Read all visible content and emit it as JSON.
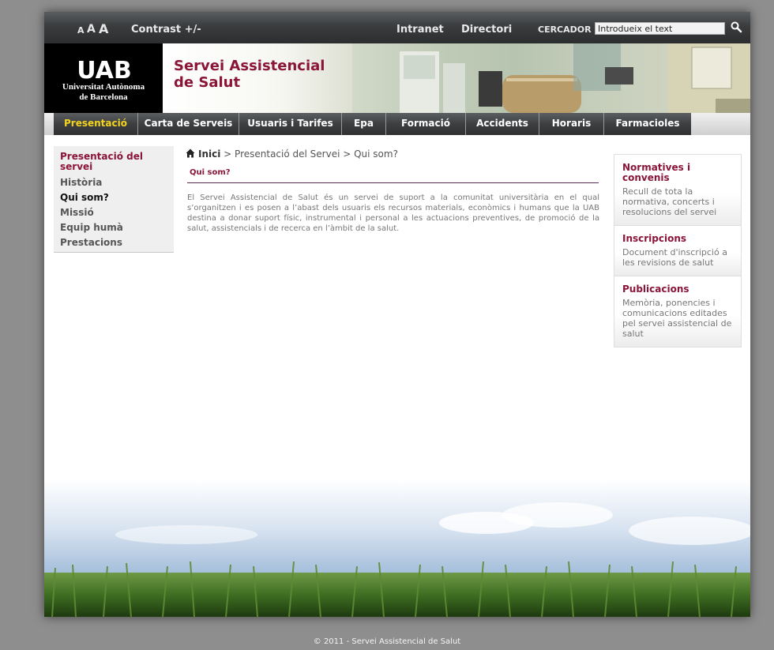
{
  "topbar": {
    "font_small": "A",
    "font_medium": "A",
    "font_large": "A",
    "contrast": "Contrast +/-",
    "intranet": "Intranet",
    "directori": "Directori",
    "search_label": "CERCADOR",
    "search_placeholder": "Introdueix el text",
    "search_icon": "magnifier-icon"
  },
  "header": {
    "logo_mark": "UAB",
    "logo_line1": "Universitat Autònoma",
    "logo_line2": "de Barcelona",
    "title_line1": "Servei Assistencial",
    "title_line2": "de Salut"
  },
  "nav": {
    "items": [
      {
        "label": "Presentació",
        "active": true
      },
      {
        "label": "Carta de Serveis",
        "active": false
      },
      {
        "label": "Usuaris i Tarifes",
        "active": false
      },
      {
        "label": "Epa",
        "active": false
      },
      {
        "label": "Formació",
        "active": false
      },
      {
        "label": "Accidents",
        "active": false
      },
      {
        "label": "Horaris",
        "active": false
      },
      {
        "label": "Farmacioles",
        "active": false
      }
    ]
  },
  "leftnav": {
    "heading": "Presentació del servei",
    "items": [
      "Història",
      "Qui som?",
      "Missió",
      "Equip humà",
      "Prestacions"
    ]
  },
  "breadcrumb": {
    "home_icon": "home-icon",
    "home": "Inici",
    "sep": " > ",
    "level1": "Presentació del Servei",
    "level2": "Qui som?"
  },
  "main": {
    "title": "Qui som?",
    "body": "El Servei Assistencial de Salut és un servei de suport a la comunitat universitària en el qual s’organitzen i es posen a l’abast dels usuaris els recursos materials, econòmics i humans que la UAB destina a donar suport físic, instrumental i personal a les actuacions preventives, de promoció de la salut, assistencials i de recerca en l’àmbit de la salut."
  },
  "sidebar_right": [
    {
      "title": "Normatives i convenis",
      "text": "Recull de tota la normativa, concerts i resolucions del servei"
    },
    {
      "title": "Inscripcions",
      "text": "Document d'inscripció a les revisions de salut"
    },
    {
      "title": "Publicacions",
      "text": "Memòria, ponencies i comunicacions editades pel servei assistencial de salut"
    }
  ],
  "footer": {
    "copyright": "© 2011 - Servei Assistencial de Salut"
  },
  "colors": {
    "brand": "#8a1538",
    "nav_active": "#f4d31e",
    "background": "#8e8e8e"
  }
}
